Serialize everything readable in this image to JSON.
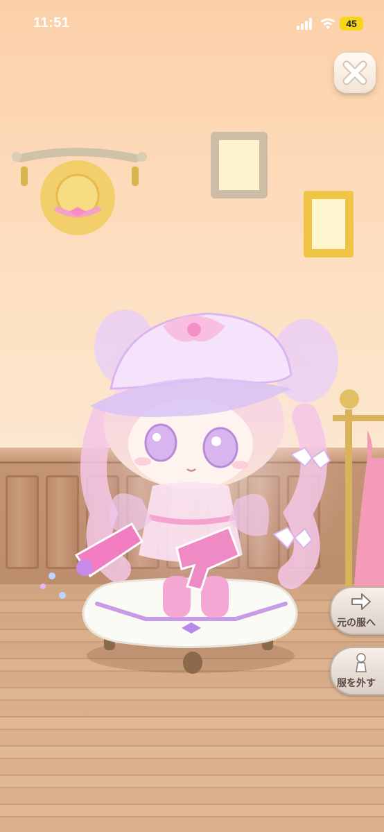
{
  "status_bar": {
    "time": "11:51",
    "battery": "45"
  },
  "buttons": {
    "close": "close",
    "revert_label": "元の服へ",
    "undress_label": "服を外す"
  },
  "icons": [
    "close-icon",
    "arrow-right-icon",
    "undress-icon",
    "signal-icon",
    "wifi-icon",
    "battery-icon"
  ],
  "colors": {
    "accent_pink": "#f7a8d8",
    "lavender": "#c8a4f0",
    "wall": "#fddcbc",
    "battery": "#f7d51d"
  }
}
